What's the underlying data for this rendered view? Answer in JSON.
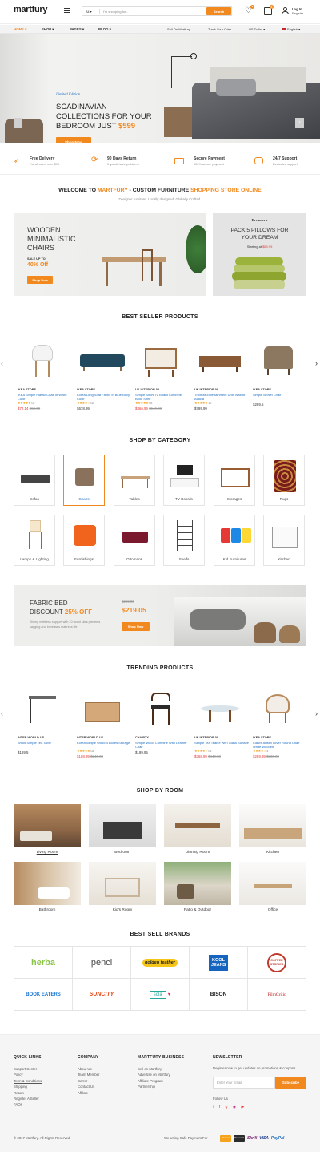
{
  "header": {
    "logo_part1": "martfury",
    "search_category": "All",
    "search_placeholder": "I'm shopping for...",
    "search_button": "Search",
    "login": "Log In",
    "register": "Register",
    "wishlist_count": "0",
    "cart_count": "0"
  },
  "nav": {
    "items": [
      "HOME",
      "SHOP",
      "PAGES",
      "BLOG"
    ],
    "right": [
      "Sell On Martfury",
      "Track Your Oder",
      "US Dollar",
      "English"
    ]
  },
  "hero": {
    "kicker": "Limited Edition",
    "line1": "SCADINAVIAN",
    "line2": "COLLECTIONS FOR YOUR",
    "line3": "BEDROOM JUST",
    "price": "$599",
    "button": "Shop Now"
  },
  "features": [
    {
      "title": "Free Delivery",
      "sub": "For all oders over $99",
      "icon": "rocket-icon"
    },
    {
      "title": "90 Days Return",
      "sub": "If goods have problems",
      "icon": "refresh-icon"
    },
    {
      "title": "Secure Payment",
      "sub": "100% secure payment",
      "icon": "credit-card-icon"
    },
    {
      "title": "24/7 Support",
      "sub": "Dedicated support",
      "icon": "chat-icon"
    }
  ],
  "welcome": {
    "prefix": "WELCOME TO ",
    "brand": "MARTFURY",
    "middle": " - CUSTOM FURNITURE ",
    "highlight": "SHOPPING STORE ONLINE",
    "sub": "Designer furniture. Locally designed. Globally Crafted."
  },
  "promo_left": {
    "line1": "WOODEN",
    "line2": "MINIMALISTIC",
    "line3": "CHAIRS",
    "sale_label": "SALE UP TO",
    "sale_value": "40% Off",
    "button": "Shop Now"
  },
  "promo_right": {
    "brand": "Dreamerk",
    "line1": "PACK 5 PILLOWS FOR",
    "line2": "YOUR DREAM",
    "starting": "Starting at",
    "price": "$59.99"
  },
  "best_seller": {
    "title": "BEST SELLER PRODUCTS",
    "products": [
      {
        "brand": "IKEA STORE",
        "name": "IKEA Simple Plastic Chair In White Color",
        "price": "$72.14",
        "old": "$84.00",
        "stars": "★★★★★",
        "reviews": "03"
      },
      {
        "brand": "IKEA STORE",
        "name": "Korea Long Sofa Fabric In Blue Navy Color",
        "price": "$678.99",
        "old": "",
        "stars": "★★★★☆",
        "reviews": "02"
      },
      {
        "brand": "UK INTERIOR 08",
        "name": "Simple Short TV Board Combine Book Shelf",
        "price": "$366.99",
        "old": "$540.00",
        "stars": "★★★★★",
        "reviews": "03"
      },
      {
        "brand": "UK INTERIOR 08",
        "name": "Thomas Entertainment Unit, Walnut Acacia",
        "price": "$799.99",
        "old": "",
        "stars": "★★★★★",
        "reviews": "10"
      },
      {
        "brand": "IKEA STORE",
        "name": "Simple Brown Chair",
        "price": "$289.5",
        "old": "",
        "stars": "",
        "reviews": ""
      }
    ]
  },
  "categories": {
    "title": "SHOP BY CATEGORY",
    "items": [
      "Sofas",
      "Chairs",
      "Tables",
      "TV Boards",
      "Storages",
      "Rugs",
      "Lamps & Lighting",
      "Furnishings",
      "Ottomans",
      "Shelfs",
      "Kid Furnitures",
      "Kitchen"
    ]
  },
  "fabric_banner": {
    "line1": "FABRIC BED",
    "line2": "DISCOUNT",
    "percent": "25% OFF",
    "old": "$269.00",
    "price": "$219.05",
    "desc": "Strong mattress support with 10 wood slats prevents sagging and increases mattress life",
    "button": "Shop Now"
  },
  "trending": {
    "title": "TRENDING PRODUCTS",
    "products": [
      {
        "brand": "INTER WORLD US",
        "name": "Wood Simple Tea Table",
        "price": "$189.5",
        "old": "",
        "stars": "",
        "reviews": ""
      },
      {
        "brand": "INTER WORLD US",
        "name": "Korea Simple Wood 4 Boxes Storage",
        "price": "$168.99",
        "old": "$240.00",
        "stars": "★★★★★",
        "reviews": "03"
      },
      {
        "brand": "CHAIRTY",
        "name": "Simple Wood Combine With Leather Chair",
        "price": "$199.95",
        "old": "",
        "stars": "",
        "reviews": ""
      },
      {
        "brand": "UK INTERIOR 08",
        "name": "Simple Tea Teable With Glass Surface",
        "price": "$368.99",
        "old": "$440.00",
        "stars": "★★★★☆",
        "reviews": "03"
      },
      {
        "brand": "IKEA STORE",
        "name": "Claure Austin Lover Round Chair White Wooden",
        "price": "$289.99",
        "old": "$330.00",
        "stars": "★★★★☆",
        "reviews": "4"
      }
    ]
  },
  "rooms": {
    "title": "SHOP BY ROOM",
    "items": [
      "Living Room",
      "Bedroom",
      "Dinning Room",
      "Kitchen",
      "Bathroom",
      "Kid's Room",
      "Patio & Outdoor",
      "Office"
    ]
  },
  "brands": {
    "title": "BEST SELL BRANDS",
    "items": [
      "herba",
      "pencl",
      "golden feather",
      "KOOL JEANS",
      "COFFEE STORIES",
      "BOOK EATERS",
      "SUNCITY",
      "sola",
      "BISON",
      "FilmCritic"
    ]
  },
  "footer": {
    "quick_title": "QUICK LINKS",
    "quick": [
      "Support Center",
      "Policy",
      "Term & Conditions",
      "Shipping",
      "Return",
      "Register A Seller",
      "FAQs"
    ],
    "company_title": "COMPANY",
    "company": [
      "About Us",
      "Team Member",
      "Carrer",
      "Contact Us",
      "Affilate"
    ],
    "business_title": "MARTFURY BUSINESS",
    "business": [
      "Sell on Martfury",
      "Advertise on Martfury",
      "Affiliate Program",
      "Partnership"
    ],
    "news_title": "NEWSLETTER",
    "news_text": "Register now to get updates on promotions & coupons",
    "email_placeholder": "Enter Your Email",
    "subscribe": "Subscribe",
    "follow": "Follow Us",
    "copyright": "© 2017 Martfury. All Rights Reserved",
    "payment_text": "We Using Safe Payment For",
    "payments": [
      "Discover",
      "Mastercard",
      "Skrill",
      "VISA",
      "PayPal"
    ]
  },
  "colors": {
    "accent": "#f2891f",
    "link": "#1b6ec2",
    "sale": "#e53935",
    "nav": "#f3f3f3"
  }
}
